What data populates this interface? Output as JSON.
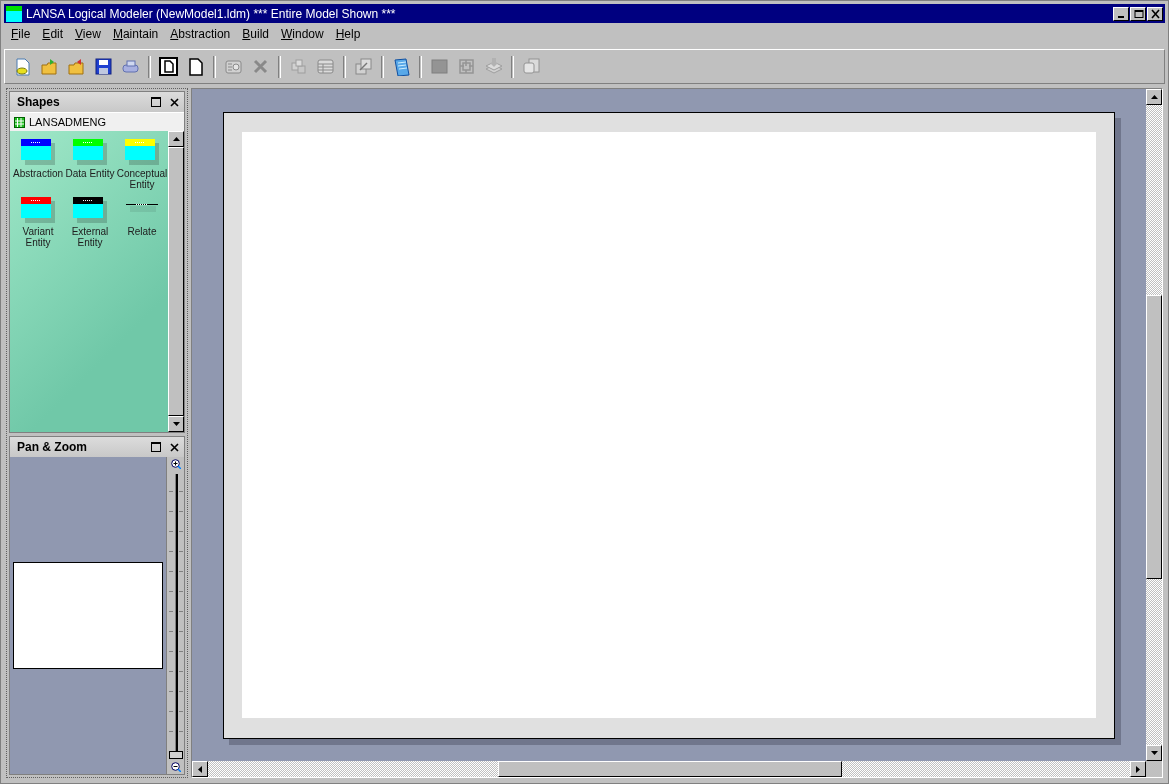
{
  "window": {
    "title": "LANSA Logical Modeler (NewModel1.ldm) *** Entire Model Shown ***"
  },
  "menu": [
    "File",
    "Edit",
    "View",
    "Maintain",
    "Abstraction",
    "Build",
    "Window",
    "Help"
  ],
  "toolbar": [
    {
      "kind": "button",
      "disabled": false
    },
    {
      "kind": "button",
      "disabled": false
    },
    {
      "kind": "button",
      "disabled": false
    },
    {
      "kind": "button",
      "disabled": false
    },
    {
      "kind": "button",
      "disabled": false
    },
    {
      "kind": "separator"
    },
    {
      "kind": "button",
      "disabled": false
    },
    {
      "kind": "button",
      "disabled": false
    },
    {
      "kind": "separator"
    },
    {
      "kind": "button",
      "disabled": true
    },
    {
      "kind": "button",
      "disabled": true
    },
    {
      "kind": "separator"
    },
    {
      "kind": "button",
      "disabled": true
    },
    {
      "kind": "button",
      "disabled": true
    },
    {
      "kind": "separator"
    },
    {
      "kind": "button",
      "disabled": true
    },
    {
      "kind": "separator"
    },
    {
      "kind": "button",
      "disabled": false
    },
    {
      "kind": "separator"
    },
    {
      "kind": "button",
      "disabled": true
    },
    {
      "kind": "button",
      "disabled": true
    },
    {
      "kind": "button",
      "disabled": true
    },
    {
      "kind": "separator"
    },
    {
      "kind": "button",
      "disabled": true
    }
  ],
  "shapes_panel": {
    "title": "Shapes",
    "library": "LANSADMENG",
    "items": [
      {
        "kind": "entity",
        "label": "Abstraction",
        "color": "#0000ff"
      },
      {
        "kind": "entity",
        "label": "Data Entity",
        "color": "#00ff00"
      },
      {
        "kind": "entity",
        "label": "Conceptual Entity",
        "color": "#ffff00"
      },
      {
        "kind": "entity",
        "label": "Variant Entity",
        "color": "#ff0000"
      },
      {
        "kind": "entity",
        "label": "External Entity",
        "color": "#000000"
      },
      {
        "kind": "line",
        "label": "Relate"
      }
    ]
  },
  "pan_zoom_panel": {
    "title": "Pan & Zoom",
    "zoom": {
      "level": 0
    }
  }
}
